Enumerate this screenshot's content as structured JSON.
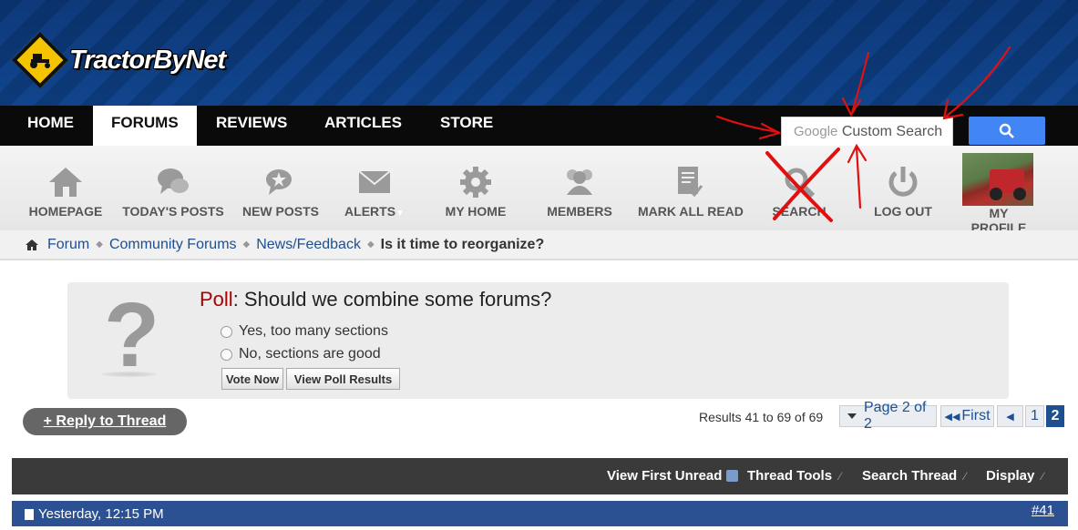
{
  "site": {
    "logo_text": "TractorByNet",
    "logo_alt": "TractorByNet"
  },
  "nav": {
    "items": [
      {
        "label": "HOME"
      },
      {
        "label": "FORUMS"
      },
      {
        "label": "REVIEWS"
      },
      {
        "label": "ARTICLES"
      },
      {
        "label": "STORE"
      }
    ],
    "active": "FORUMS"
  },
  "search": {
    "brand": "Google",
    "placeholder": "Custom Search",
    "button_icon": "search-icon"
  },
  "toolbar": {
    "items": [
      {
        "label": "HOMEPAGE",
        "icon": "home-icon"
      },
      {
        "label": "TODAY'S POSTS",
        "icon": "chat-bubbles-icon"
      },
      {
        "label": "NEW POSTS",
        "icon": "new-posts-icon"
      },
      {
        "label": "ALERTS",
        "icon": "envelope-icon"
      },
      {
        "label": "MY HOME",
        "icon": "gear-icon"
      },
      {
        "label": "MEMBERS",
        "icon": "members-icon"
      },
      {
        "label": "MARK ALL READ",
        "icon": "mark-read-icon"
      },
      {
        "label": "SEARCH",
        "icon": "search-icon"
      },
      {
        "label": "LOG OUT",
        "icon": "power-icon"
      }
    ],
    "profile_label": "MY PROFILE"
  },
  "breadcrumb": {
    "items": [
      "Forum",
      "Community Forums",
      "News/Feedback"
    ],
    "current": "Is it time to reorganize?"
  },
  "poll": {
    "prefix": "Poll",
    "question": "Should we combine some forums?",
    "options": [
      "Yes, too many sections",
      "No, sections are good"
    ],
    "vote_label": "Vote Now",
    "results_label": "View Poll Results"
  },
  "reply_label": "+ Reply to Thread",
  "pagination": {
    "results_text": "Results 41 to 69 of 69",
    "page_label": "Page 2 of 2",
    "first_label": "First",
    "pages": [
      "1",
      "2"
    ],
    "current_page": "2"
  },
  "thread_bar": {
    "view_first_unread": "View First Unread",
    "thread_tools": "Thread Tools",
    "search_thread": "Search Thread",
    "display": "Display"
  },
  "post": {
    "timestamp": "Yesterday, 12:15 PM",
    "number": "#41"
  },
  "colors": {
    "nav_bg": "#0a0a0a",
    "link": "#1d4f91",
    "post_header": "#2c5193",
    "annotation": "#e01010",
    "search_button": "#4285f4"
  }
}
